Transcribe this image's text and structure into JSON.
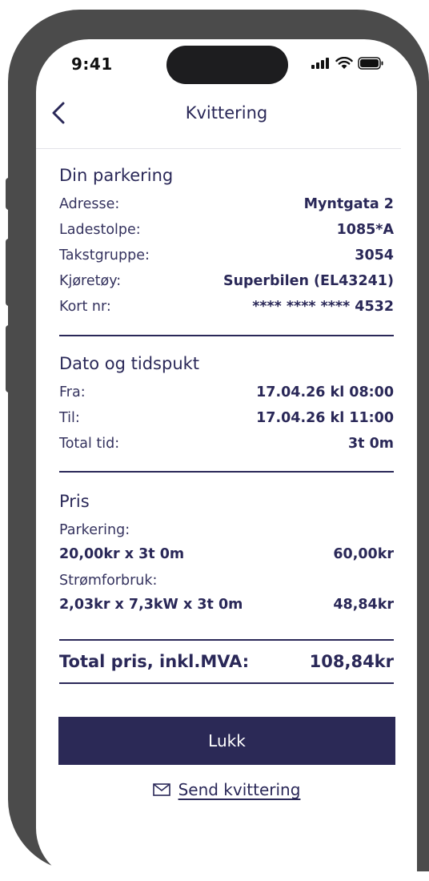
{
  "status_bar": {
    "time": "9:41",
    "icons": [
      "signal-icon",
      "wifi-icon",
      "battery-icon"
    ]
  },
  "nav": {
    "title": "Kvittering",
    "back_icon": "chevron-left-icon"
  },
  "parking": {
    "title": "Din parkering",
    "rows": [
      {
        "label": "Adresse:",
        "value": "Myntgata 2"
      },
      {
        "label": "Ladestolpe:",
        "value": "1085*A"
      },
      {
        "label": "Takstgruppe:",
        "value": "3054"
      },
      {
        "label": "Kjøretøy:",
        "value": "Superbilen (EL43241)"
      },
      {
        "label": "Kort nr:",
        "value": "**** **** **** 4532"
      }
    ]
  },
  "time": {
    "title": "Dato og tidspukt",
    "rows": [
      {
        "label": "Fra:",
        "value": "17.04.26 kl 08:00"
      },
      {
        "label": "Til:",
        "value": "17.04.26 kl 11:00"
      },
      {
        "label": "Total tid:",
        "value": "3t 0m"
      }
    ]
  },
  "price": {
    "title": "Pris",
    "items": [
      {
        "label": "Parkering:",
        "calc": "20,00kr x 3t 0m",
        "amount": "60,00kr"
      },
      {
        "label": "Strømforbruk:",
        "calc": "2,03kr x 7,3kW x 3t 0m",
        "amount": "48,84kr"
      }
    ]
  },
  "total": {
    "label": "Total pris, inkl.MVA:",
    "value": "108,84kr"
  },
  "actions": {
    "close_label": "Lukk",
    "send_label": "Send kvittering",
    "send_icon": "mail-icon"
  },
  "colors": {
    "primary": "#2b2956",
    "text": "#2a2858",
    "frame": "#4b4b4b"
  }
}
